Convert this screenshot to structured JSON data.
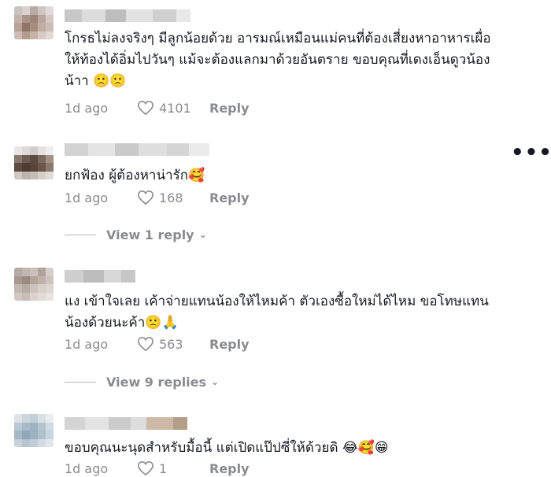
{
  "comments": [
    {
      "text": "โกรธไม่ลงจริงๆ มีลูกน้อยด้วย อารมณ์เหมือนแม่คนที่ต้องเสี่ยงหาอาหารเผื่อ\nให้ท้องได้อิ่มไปวันๆ แม้จะต้องแลกมาด้วยอันตราย ขอบคุณที่เดงเอ็นดูวน้อง\nน้าา 🙁🙁",
      "time": "1d ago",
      "likes": "4101",
      "reply_label": "Reply"
    },
    {
      "text": "ยกฟ้อง ผู้ต้องหาน่ารัก🥰",
      "time": "1d ago",
      "likes": "168",
      "reply_label": "Reply",
      "view_replies": "View 1 reply"
    },
    {
      "text": "แง เข้าใจเลย เค้าจ่ายแทนน้องให้ไหมค้า ตัวเองซื้อใหม่ได้ไหม ขอโทษแทน\nน้องด้วยนะค้า🙁🙏",
      "time": "1d ago",
      "likes": "563",
      "reply_label": "Reply",
      "view_replies": "View 9 replies"
    },
    {
      "text": "ขอบคุณนะนุดสำหรับมื้อนี้ แต่เปิดแป๊ปซี่ให้ด้วยดิ 😂🥰😁",
      "time": "1d ago",
      "likes": "1",
      "reply_label": "Reply"
    }
  ],
  "more_icon": "more-horizontal-icon",
  "like_icon": "heart-outline-icon",
  "colors": {
    "text": "#161823",
    "muted": "#8a8b91"
  }
}
